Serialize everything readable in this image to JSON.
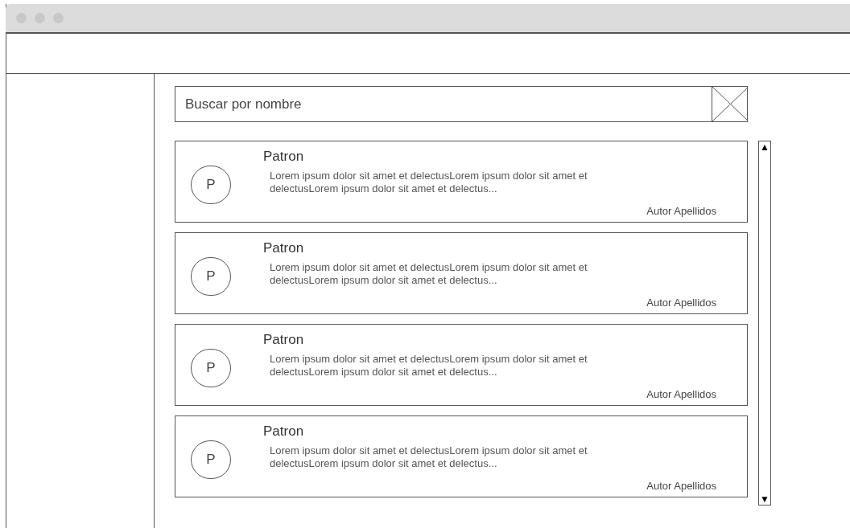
{
  "search": {
    "placeholder": "Buscar por nombre"
  },
  "cards": [
    {
      "avatar": "P",
      "title": "Patron",
      "description": "Lorem ipsum dolor sit amet et delectusLorem ipsum dolor sit amet et delectusLorem ipsum dolor sit amet et delectus...",
      "author": "Autor Apellidos"
    },
    {
      "avatar": "P",
      "title": "Patron",
      "description": "Lorem ipsum dolor sit amet et delectusLorem ipsum dolor sit amet et delectusLorem ipsum dolor sit amet et delectus...",
      "author": "Autor Apellidos"
    },
    {
      "avatar": "P",
      "title": "Patron",
      "description": "Lorem ipsum dolor sit amet et delectusLorem ipsum dolor sit amet et delectusLorem ipsum dolor sit amet et delectus...",
      "author": "Autor Apellidos"
    },
    {
      "avatar": "P",
      "title": "Patron",
      "description": "Lorem ipsum dolor sit amet et delectusLorem ipsum dolor sit amet et delectusLorem ipsum dolor sit amet et delectus...",
      "author": "Autor Apellidos"
    }
  ],
  "scrollbar": {
    "up": "▲",
    "down": "▼"
  }
}
